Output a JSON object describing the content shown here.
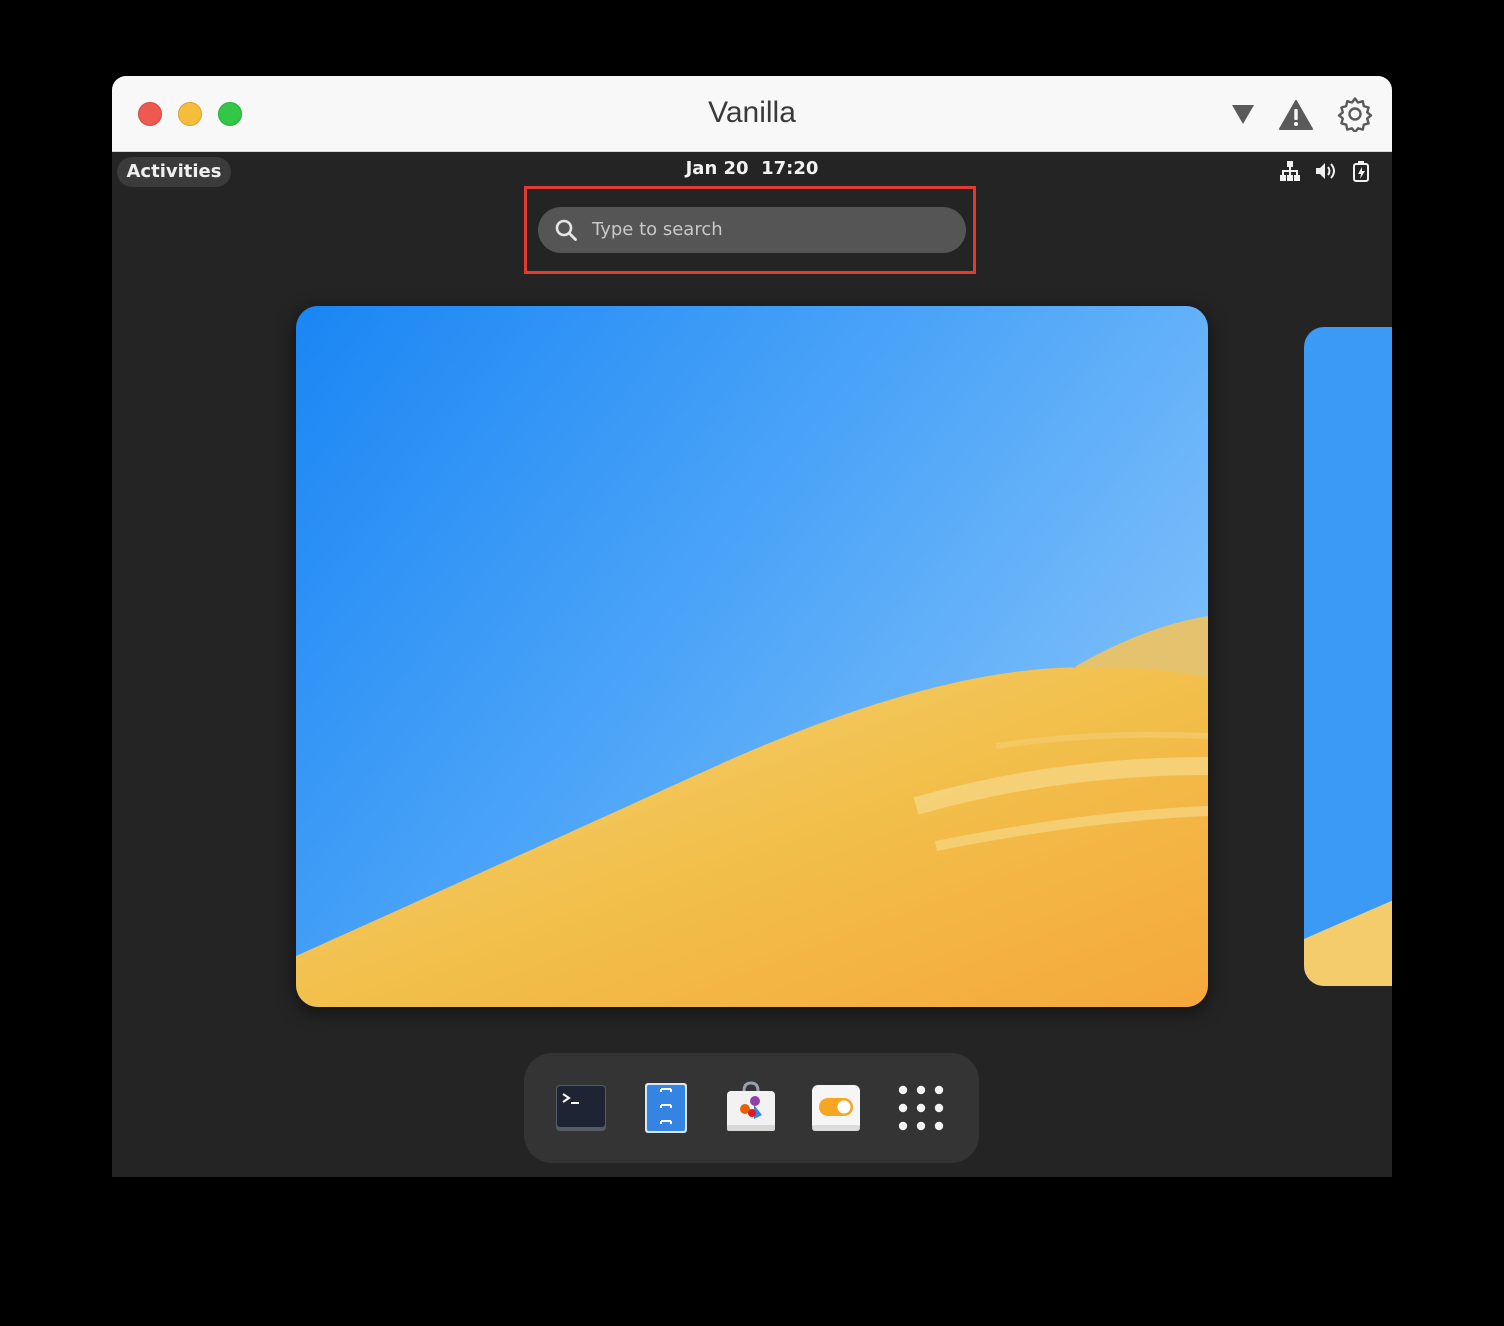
{
  "window": {
    "title": "Vanilla",
    "traffic_lights": [
      "close",
      "minimize",
      "maximize"
    ],
    "toolbar_icons": [
      "dropdown-arrow-icon",
      "warning-icon",
      "gear-icon"
    ]
  },
  "top_bar": {
    "activities_label": "Activities",
    "clock": "Jan 20  17:20",
    "tray_icons": [
      "network-icon",
      "volume-icon",
      "battery-icon"
    ]
  },
  "search": {
    "placeholder": "Type to search"
  },
  "dock": {
    "items": [
      {
        "name": "terminal-icon"
      },
      {
        "name": "files-icon"
      },
      {
        "name": "software-store-icon"
      },
      {
        "name": "settings-toggle-icon"
      },
      {
        "name": "show-apps-icon"
      }
    ]
  },
  "colors": {
    "highlight_border": "#e23a2e",
    "sky": "#2b8ff0",
    "sand": "#f3c04e"
  }
}
